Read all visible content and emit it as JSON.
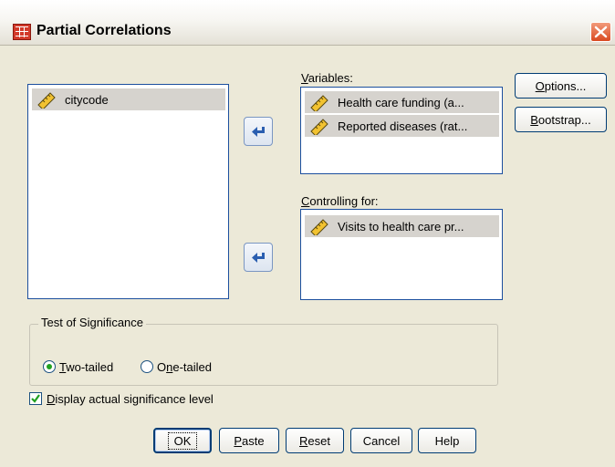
{
  "window": {
    "title": "Partial Correlations"
  },
  "source_list": {
    "items": [
      "citycode"
    ]
  },
  "variables": {
    "label_underline": "V",
    "label_rest": "ariables:",
    "items": [
      "Health care funding (a...",
      "Reported diseases (rat..."
    ]
  },
  "controlling": {
    "label_underline": "C",
    "label_rest": "ontrolling for:",
    "items": [
      "Visits to health care pr..."
    ]
  },
  "side_buttons": {
    "options_u": "O",
    "options_rest": "ptions...",
    "bootstrap_u": "B",
    "bootstrap_rest": "ootstrap..."
  },
  "significance": {
    "title": "Test of Significance",
    "two_tailed_u": "T",
    "two_tailed_rest": "wo-tailed",
    "one_tailed_pre": "O",
    "one_tailed_u": "n",
    "one_tailed_rest": "e-tailed",
    "selected": "Two-tailed"
  },
  "display_actual": {
    "u": "D",
    "rest": "isplay actual significance level",
    "checked": true
  },
  "bottom_buttons": {
    "ok": "OK",
    "paste_u": "P",
    "paste_rest": "aste",
    "reset_u": "R",
    "reset_rest": "eset",
    "cancel": "Cancel",
    "help": "Help"
  },
  "colors": {
    "accent": "#003c74",
    "selection": "#d6d3ce",
    "radio_dot": "#21a121"
  },
  "icons": {
    "variable": "ruler-scale-icon",
    "move": "arrow-left-icon"
  }
}
